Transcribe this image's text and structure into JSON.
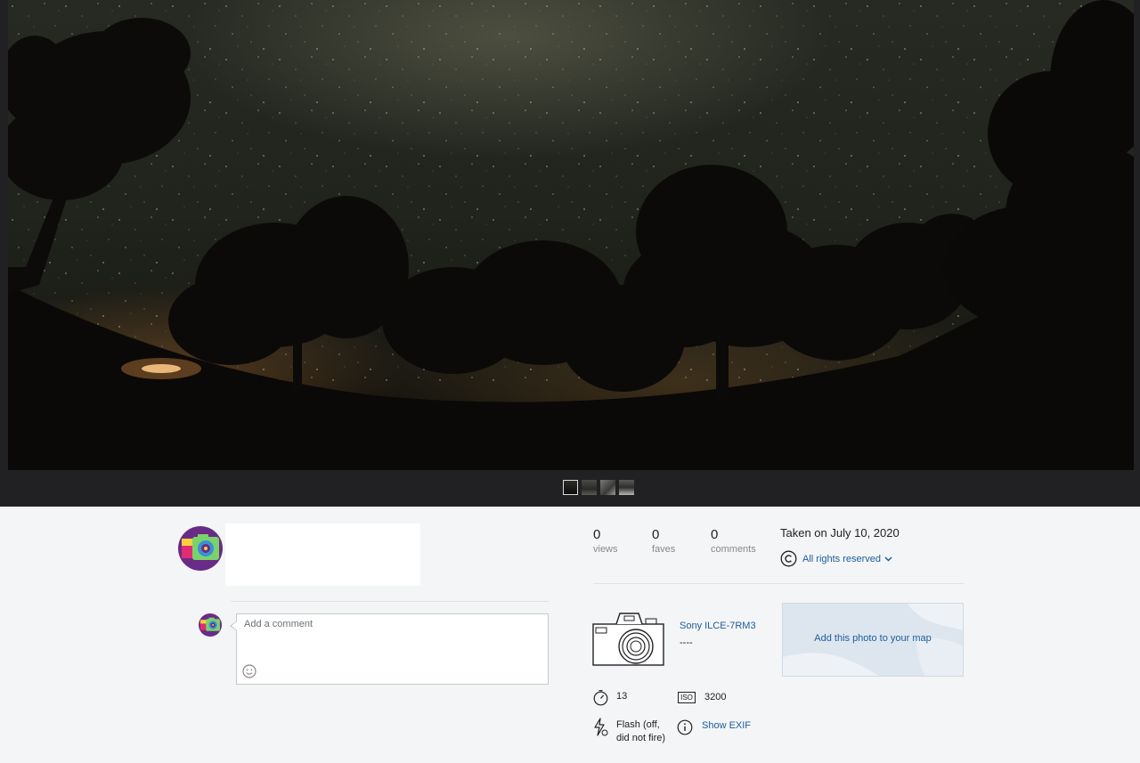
{
  "photo": {
    "thumbnails": [
      "thumbnail-1",
      "thumbnail-2",
      "thumbnail-3",
      "thumbnail-4"
    ],
    "active_thumbnail": 0
  },
  "comment": {
    "placeholder": "Add a comment"
  },
  "stats": {
    "views": {
      "value": "0",
      "label": "views"
    },
    "faves": {
      "value": "0",
      "label": "faves"
    },
    "comments": {
      "value": "0",
      "label": "comments"
    }
  },
  "taken": "Taken on July 10, 2020",
  "license": "All rights reserved",
  "camera": {
    "name": "Sony ILCE-7RM3",
    "lens": "----"
  },
  "map": {
    "label": "Add this photo to your map"
  },
  "exif": {
    "shutter": "13",
    "iso_icon": "ISO",
    "iso": "3200",
    "flash": "Flash (off, did not fire)",
    "show_exif": "Show EXIF"
  },
  "colors": {
    "link": "#1c5c9c",
    "viewer_background": "#212124",
    "page_background": "#f3f5f6",
    "avatar": "#6a2b86"
  }
}
